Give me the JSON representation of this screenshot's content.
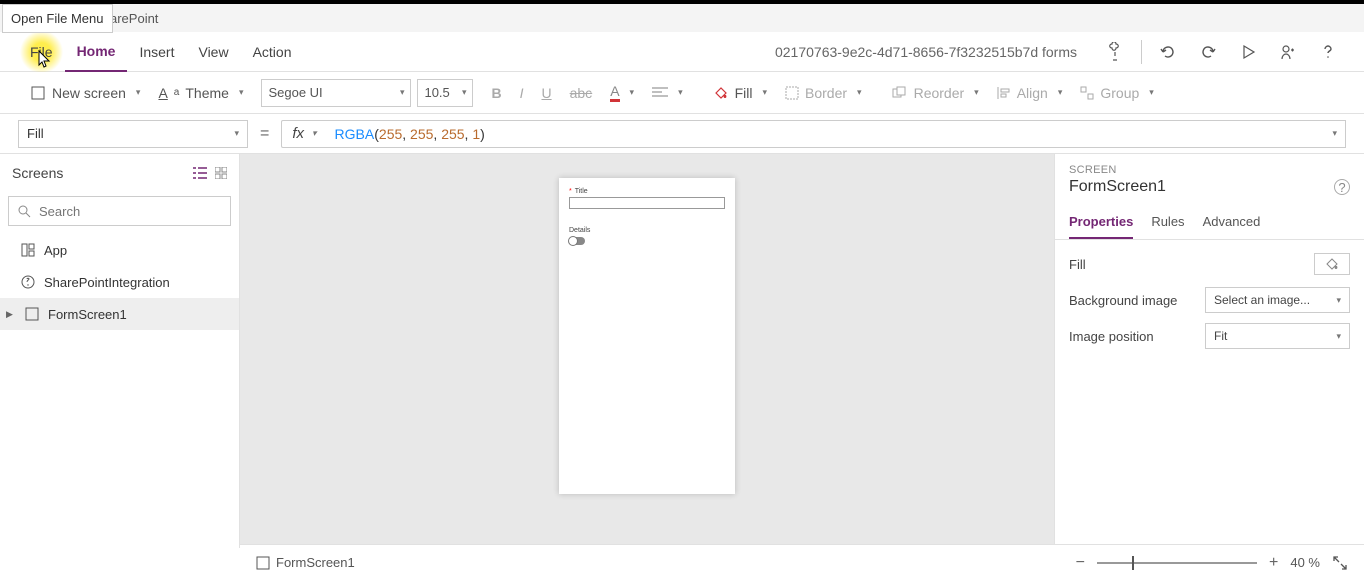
{
  "tooltip": "Open File Menu",
  "titlebar": {
    "product": "arePoint"
  },
  "menu": {
    "file": "File",
    "home": "Home",
    "insert": "Insert",
    "view": "View",
    "action": "Action",
    "app_id": "02170763-9e2c-4d71-8656-7f3232515b7d forms"
  },
  "ribbon": {
    "new_screen": "New screen",
    "theme": "Theme",
    "font": "Segoe UI",
    "size": "10.5",
    "fill": "Fill",
    "border": "Border",
    "reorder": "Reorder",
    "align": "Align",
    "group": "Group"
  },
  "formula": {
    "property": "Fill",
    "fn": "RGBA",
    "args": [
      "255",
      "255",
      "255",
      "1"
    ]
  },
  "left": {
    "title": "Screens",
    "search_placeholder": "Search",
    "items": {
      "app": "App",
      "sp": "SharePointIntegration",
      "screen": "FormScreen1"
    }
  },
  "canvas": {
    "field1_label": "Title",
    "field2_label": "Details"
  },
  "right": {
    "section": "SCREEN",
    "title": "FormScreen1",
    "tabs": {
      "properties": "Properties",
      "rules": "Rules",
      "advanced": "Advanced"
    },
    "props": {
      "fill": "Fill",
      "bg_image": "Background image",
      "bg_image_value": "Select an image...",
      "img_pos": "Image position",
      "img_pos_value": "Fit"
    }
  },
  "status": {
    "breadcrumb": "FormScreen1",
    "zoom": "40  %"
  }
}
